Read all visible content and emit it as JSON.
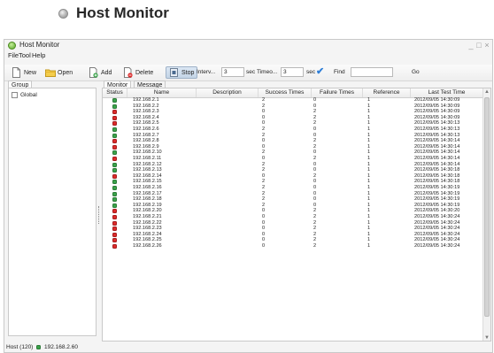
{
  "heading": {
    "text": "Host Monitor"
  },
  "window": {
    "title": "Host Monitor",
    "controls": {
      "minimize": "_",
      "maximize": "□",
      "close": "×"
    }
  },
  "menu": [
    {
      "key": "file",
      "label": "File"
    },
    {
      "key": "tool",
      "label": "Tool"
    },
    {
      "key": "help",
      "label": "Help"
    }
  ],
  "toolbar": {
    "new_label": "New",
    "open_label": "Open",
    "add_label": "Add",
    "delete_label": "Delete",
    "stop_label": "Stop",
    "interval_label": "Interv...",
    "interval_value": "3",
    "interval_unit": "sec",
    "timeout_label": "Timeo...",
    "timeout_value": "3",
    "timeout_unit": "sec",
    "find_label": "Find",
    "find_value": "",
    "go_label": "Go"
  },
  "left_tabs": {
    "group_label": "Group"
  },
  "groups": [
    {
      "label": "Global"
    }
  ],
  "right_tabs": {
    "monitor_label": "Monitor",
    "message_label": "Message"
  },
  "columns": [
    "Status",
    "Name",
    "Description",
    "Success Times",
    "Failure Times",
    "Reference",
    "Last Test Time"
  ],
  "colors": {
    "up": "#3aa34a",
    "down": "#dd2a2a",
    "accent": "#2f7fd8"
  },
  "rows": [
    {
      "status": "up",
      "name": "192.168.2.1",
      "description": "",
      "success": "2",
      "failure": "0",
      "reference": "1",
      "last_test": "2012/09/05 14:30:09"
    },
    {
      "status": "up",
      "name": "192.168.2.2",
      "description": "",
      "success": "2",
      "failure": "0",
      "reference": "1",
      "last_test": "2012/09/05 14:30:09"
    },
    {
      "status": "down",
      "name": "192.168.2.3",
      "description": "",
      "success": "0",
      "failure": "2",
      "reference": "1",
      "last_test": "2012/09/05 14:30:09"
    },
    {
      "status": "down",
      "name": "192.168.2.4",
      "description": "",
      "success": "0",
      "failure": "2",
      "reference": "1",
      "last_test": "2012/09/05 14:30:09"
    },
    {
      "status": "down",
      "name": "192.168.2.5",
      "description": "",
      "success": "0",
      "failure": "2",
      "reference": "1",
      "last_test": "2012/09/05 14:30:13"
    },
    {
      "status": "up",
      "name": "192.168.2.6",
      "description": "",
      "success": "2",
      "failure": "0",
      "reference": "1",
      "last_test": "2012/09/05 14:30:13"
    },
    {
      "status": "up",
      "name": "192.168.2.7",
      "description": "",
      "success": "2",
      "failure": "0",
      "reference": "1",
      "last_test": "2012/09/05 14:30:13"
    },
    {
      "status": "down",
      "name": "192.168.2.8",
      "description": "",
      "success": "0",
      "failure": "2",
      "reference": "1",
      "last_test": "2012/09/05 14:30:14"
    },
    {
      "status": "down",
      "name": "192.168.2.9",
      "description": "",
      "success": "0",
      "failure": "2",
      "reference": "1",
      "last_test": "2012/09/05 14:30:14"
    },
    {
      "status": "up",
      "name": "192.168.2.10",
      "description": "",
      "success": "2",
      "failure": "0",
      "reference": "1",
      "last_test": "2012/09/05 14:30:14"
    },
    {
      "status": "down",
      "name": "192.168.2.11",
      "description": "",
      "success": "0",
      "failure": "2",
      "reference": "1",
      "last_test": "2012/09/05 14:30:14"
    },
    {
      "status": "up",
      "name": "192.168.2.12",
      "description": "",
      "success": "2",
      "failure": "0",
      "reference": "1",
      "last_test": "2012/09/05 14:30:14"
    },
    {
      "status": "up",
      "name": "192.168.2.13",
      "description": "",
      "success": "2",
      "failure": "0",
      "reference": "1",
      "last_test": "2012/09/05 14:30:18"
    },
    {
      "status": "down",
      "name": "192.168.2.14",
      "description": "",
      "success": "0",
      "failure": "2",
      "reference": "1",
      "last_test": "2012/09/05 14:30:18"
    },
    {
      "status": "up",
      "name": "192.168.2.15",
      "description": "",
      "success": "2",
      "failure": "0",
      "reference": "1",
      "last_test": "2012/09/05 14:30:18"
    },
    {
      "status": "up",
      "name": "192.168.2.16",
      "description": "",
      "success": "2",
      "failure": "0",
      "reference": "1",
      "last_test": "2012/09/05 14:30:19"
    },
    {
      "status": "up",
      "name": "192.168.2.17",
      "description": "",
      "success": "2",
      "failure": "0",
      "reference": "1",
      "last_test": "2012/09/05 14:30:19"
    },
    {
      "status": "up",
      "name": "192.168.2.18",
      "description": "",
      "success": "2",
      "failure": "0",
      "reference": "1",
      "last_test": "2012/09/05 14:30:19"
    },
    {
      "status": "up",
      "name": "192.168.2.19",
      "description": "",
      "success": "2",
      "failure": "0",
      "reference": "1",
      "last_test": "2012/09/05 14:30:19"
    },
    {
      "status": "down",
      "name": "192.168.2.20",
      "description": "",
      "success": "0",
      "failure": "2",
      "reference": "1",
      "last_test": "2012/09/05 14:30:20"
    },
    {
      "status": "down",
      "name": "192.168.2.21",
      "description": "",
      "success": "0",
      "failure": "2",
      "reference": "1",
      "last_test": "2012/09/05 14:30:24"
    },
    {
      "status": "down",
      "name": "192.168.2.22",
      "description": "",
      "success": "0",
      "failure": "2",
      "reference": "1",
      "last_test": "2012/09/05 14:30:24"
    },
    {
      "status": "down",
      "name": "192.168.2.23",
      "description": "",
      "success": "0",
      "failure": "2",
      "reference": "1",
      "last_test": "2012/09/05 14:30:24"
    },
    {
      "status": "down",
      "name": "192.168.2.24",
      "description": "",
      "success": "0",
      "failure": "2",
      "reference": "1",
      "last_test": "2012/09/05 14:30:24"
    },
    {
      "status": "down",
      "name": "192.168.2.25",
      "description": "",
      "success": "0",
      "failure": "2",
      "reference": "1",
      "last_test": "2012/09/05 14:30:24"
    },
    {
      "status": "down",
      "name": "192.168.2.26",
      "description": "",
      "success": "0",
      "failure": "2",
      "reference": "1",
      "last_test": "2012/09/05 14:30:24"
    }
  ],
  "statusbar": {
    "host_count": "Host (120)",
    "selected_host": "192.168.2.60",
    "selected_status": "up"
  }
}
